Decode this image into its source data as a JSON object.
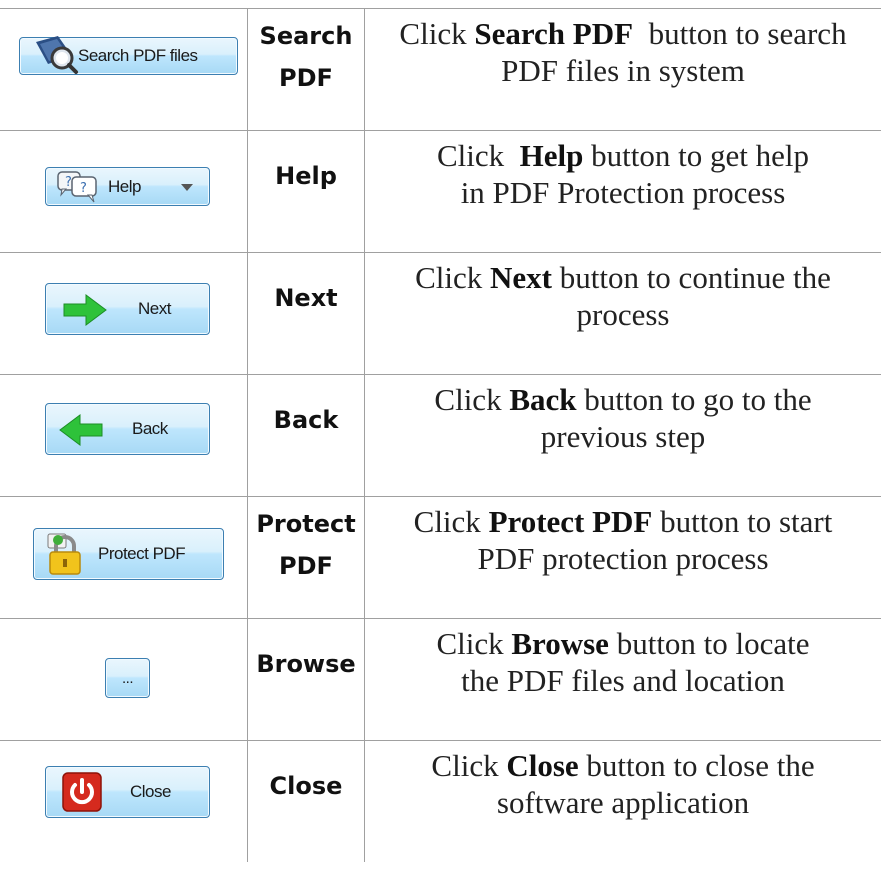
{
  "rows": [
    {
      "button_label": "Search PDF files",
      "name_lines": [
        "Search",
        "PDF"
      ],
      "desc_pre": "Click ",
      "desc_bold": "Search PDF",
      "desc_post": "  button to search",
      "desc_line2": "PDF files in system",
      "icon": "magnifier-icon"
    },
    {
      "button_label": "Help",
      "name_lines": [
        "Help"
      ],
      "desc_pre": "Click  ",
      "desc_bold": "Help",
      "desc_post": " button to get help",
      "desc_line2": "in PDF Protection process",
      "icon": "help-speech-icon"
    },
    {
      "button_label": "Next",
      "name_lines": [
        "Next"
      ],
      "desc_pre": "Click ",
      "desc_bold": "Next",
      "desc_post": " button to continue the",
      "desc_line2": "process",
      "icon": "green-right-arrow-icon"
    },
    {
      "button_label": "Back",
      "name_lines": [
        "Back"
      ],
      "desc_pre": "Click ",
      "desc_bold": "Back",
      "desc_post": " button to go to the",
      "desc_line2": "previous step",
      "icon": "green-left-arrow-icon"
    },
    {
      "button_label": "Protect PDF",
      "name_lines": [
        "Protect",
        "PDF"
      ],
      "desc_pre": "Click ",
      "desc_bold": "Protect PDF",
      "desc_post": " button to start",
      "desc_line2": "PDF protection process",
      "icon": "padlock-icon"
    },
    {
      "button_label": "...",
      "name_lines": [
        "Browse"
      ],
      "desc_pre": "Click ",
      "desc_bold": "Browse",
      "desc_post": " button to locate",
      "desc_line2": "the PDF files and location",
      "icon": ""
    },
    {
      "button_label": "Close",
      "name_lines": [
        "Close"
      ],
      "desc_pre": "Click ",
      "desc_bold": "Close",
      "desc_post": " button to close the",
      "desc_line2": "software application",
      "icon": "power-icon"
    }
  ]
}
